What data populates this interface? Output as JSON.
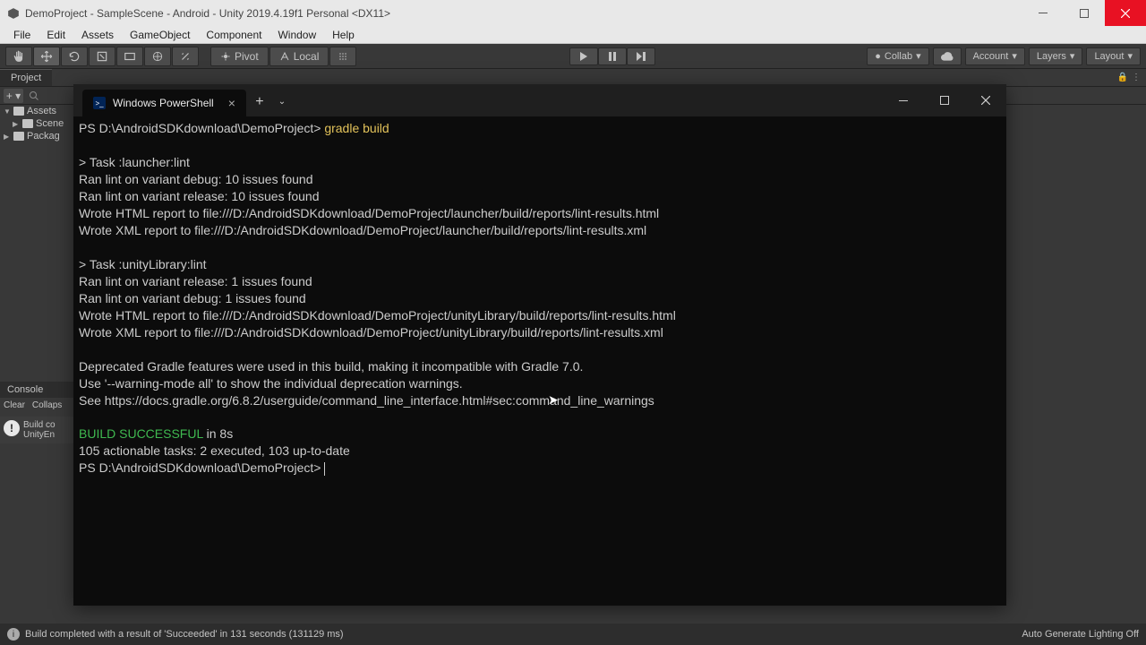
{
  "window": {
    "title": "DemoProject - SampleScene - Android - Unity 2019.4.19f1 Personal <DX11>"
  },
  "menu": [
    "File",
    "Edit",
    "Assets",
    "GameObject",
    "Component",
    "Window",
    "Help"
  ],
  "toolbar": {
    "pivot": "Pivot",
    "local": "Local",
    "collab": "Collab",
    "account": "Account",
    "layers": "Layers",
    "layout": "Layout"
  },
  "project": {
    "tab": "Project",
    "tree": {
      "root": "Assets",
      "items": [
        "Scene",
        "Packag"
      ]
    }
  },
  "console": {
    "tab": "Console",
    "buttons": [
      "Clear",
      "Collaps"
    ],
    "msg1": "Build co",
    "msg2": "UnityEn"
  },
  "terminal": {
    "tab_title": "Windows PowerShell",
    "prompt1": "PS D:\\AndroidSDKdownload\\DemoProject> ",
    "cmd1": "gradle build",
    "out": [
      "",
      "> Task :launcher:lint",
      "Ran lint on variant debug: 10 issues found",
      "Ran lint on variant release: 10 issues found",
      "Wrote HTML report to file:///D:/AndroidSDKdownload/DemoProject/launcher/build/reports/lint-results.html",
      "Wrote XML report to file:///D:/AndroidSDKdownload/DemoProject/launcher/build/reports/lint-results.xml",
      "",
      "> Task :unityLibrary:lint",
      "Ran lint on variant release: 1 issues found",
      "Ran lint on variant debug: 1 issues found",
      "Wrote HTML report to file:///D:/AndroidSDKdownload/DemoProject/unityLibrary/build/reports/lint-results.html",
      "Wrote XML report to file:///D:/AndroidSDKdownload/DemoProject/unityLibrary/build/reports/lint-results.xml",
      "",
      "Deprecated Gradle features were used in this build, making it incompatible with Gradle 7.0.",
      "Use '--warning-mode all' to show the individual deprecation warnings.",
      "See https://docs.gradle.org/6.8.2/userguide/command_line_interface.html#sec:command_line_warnings"
    ],
    "success": "BUILD SUCCESSFUL",
    "success_tail": " in 8s",
    "tasks": "105 actionable tasks: 2 executed, 103 up-to-date",
    "prompt2": "PS D:\\AndroidSDKdownload\\DemoProject> "
  },
  "status": {
    "left": "Build completed with a result of 'Succeeded' in 131 seconds (131129 ms)",
    "right": "Auto Generate Lighting Off"
  }
}
